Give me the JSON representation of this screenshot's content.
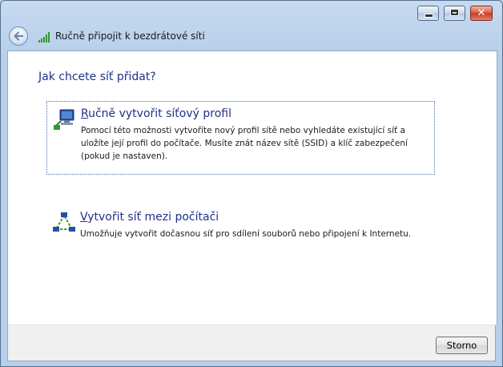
{
  "window": {
    "title": "Ručně připojit k bezdrátové síti",
    "controls": {
      "minimize": "minimize-icon",
      "maximize": "maximize-icon",
      "close": "✕"
    }
  },
  "heading": "Jak chcete síť přidat?",
  "options": [
    {
      "title": "Ručně vytvořit síťový profil",
      "description": "Pomocí této možnosti vytvoříte nový profil sítě nebo vyhledáte existující síť a uložíte její profil do počítače. Musíte znát název sítě (SSID) a klíč zabezpečení (pokud je nastaven).",
      "icon": "network-computer-icon"
    },
    {
      "title": "Vytvořit síť mezi počítači",
      "description": "Umožňuje vytvořit dočasnou síť pro sdílení souborů nebo připojení k Internetu.",
      "icon": "adhoc-network-icon"
    }
  ],
  "footer": {
    "cancel_label": "Storno"
  },
  "colors": {
    "link": "#1e3287",
    "frame": "#bcd4ec"
  }
}
